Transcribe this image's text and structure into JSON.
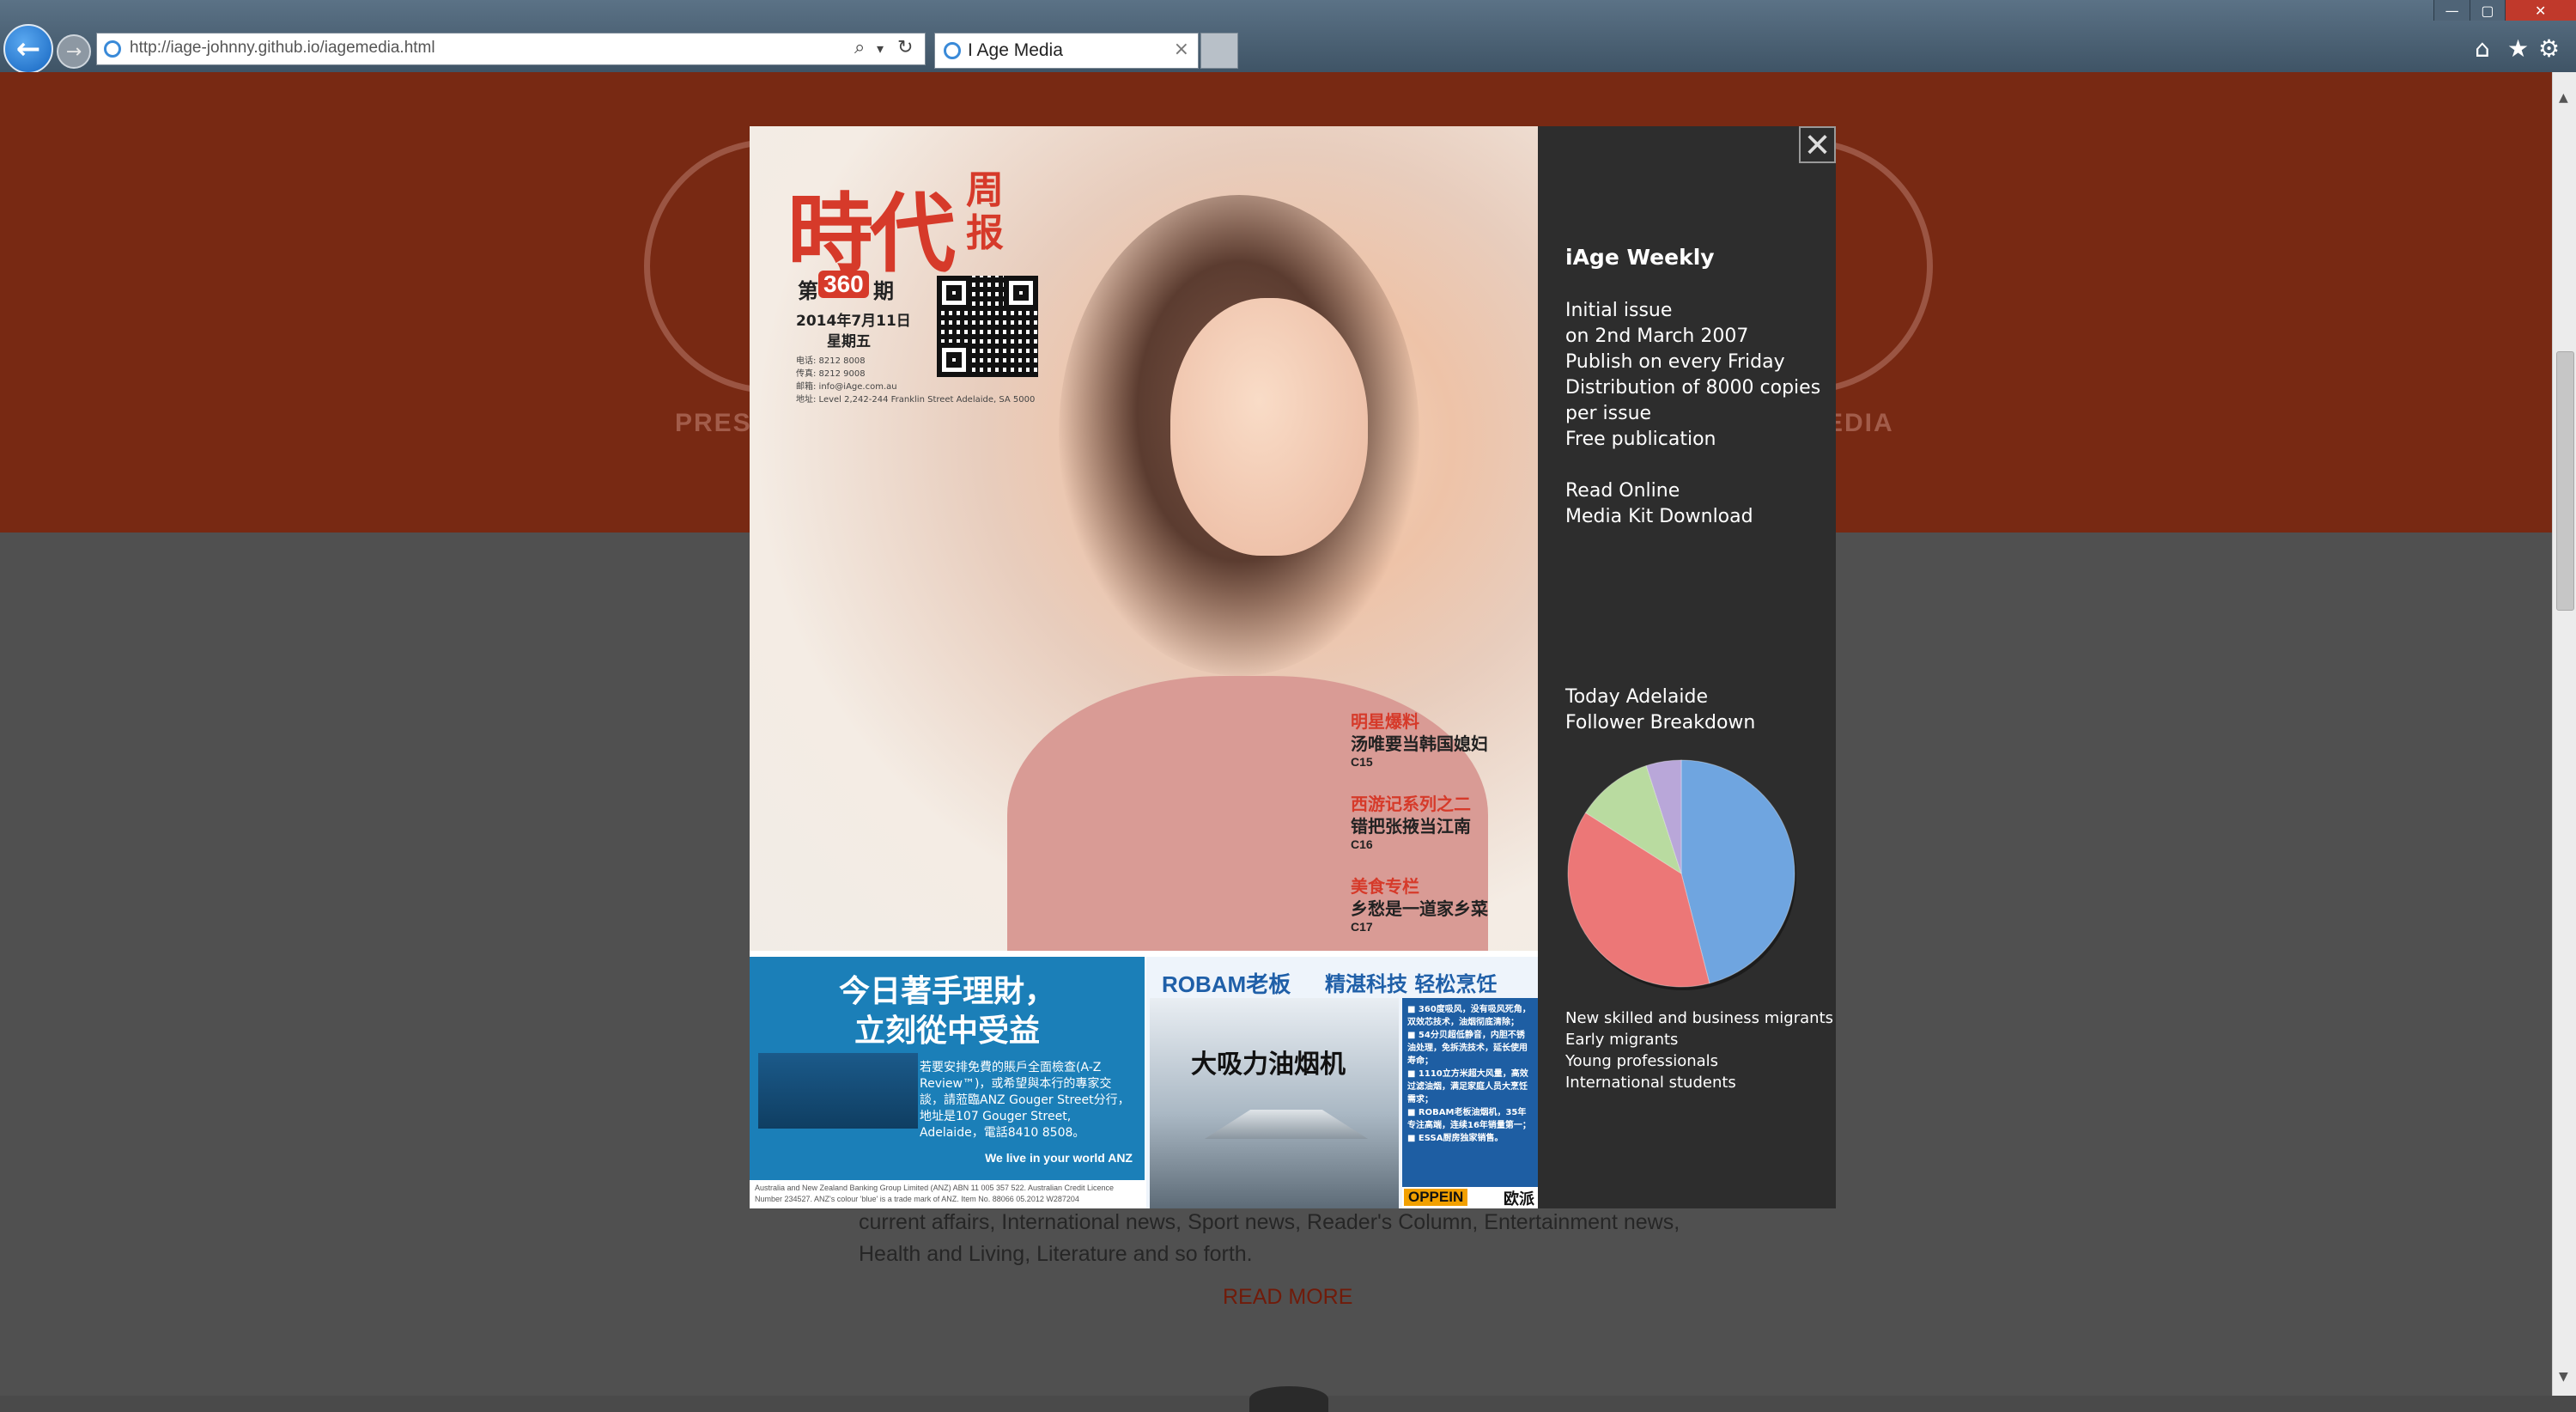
{
  "browser": {
    "url": "http://iage-johnny.github.io/iagemedia.html",
    "tab_title": "I Age Media",
    "back_glyph": "←",
    "forward_glyph": "→",
    "search_glyph": "⌕",
    "refresh_glyph": "↻",
    "dropdown_glyph": "▾",
    "tab_close_glyph": "×",
    "min_glyph": "—",
    "max_glyph": "▢",
    "close_glyph": "✕",
    "home_glyph": "⌂",
    "favorites_glyph": "★",
    "tools_glyph": "⚙",
    "icons": [
      "back-arrow-icon",
      "forward-arrow-icon",
      "search-icon",
      "refresh-icon",
      "home-icon",
      "star-icon",
      "gear-icon"
    ]
  },
  "page": {
    "header_left_label": "PRES",
    "header_right_label": "EDIA",
    "body_text": "current affairs, International news, Sport news, Reader's Column, Entertainment news, Health and Living, Literature and so forth.",
    "read_more": "READ MORE",
    "brand_color": "#782913"
  },
  "modal": {
    "close_glyph": "✕",
    "cover": {
      "logo": "時代",
      "logo_sub": "周报",
      "issue_prefix": "第",
      "issue_number": "360",
      "issue_suffix": "期",
      "date": "2014年7月11日",
      "weekday": "星期五",
      "contact": "电话: 8212 8008\n传真: 8212 9008\n邮箱: info@iAge.com.au\n地址: Level 2,242-244 Franklin Street Adelaide, SA 5000",
      "headlines": [
        {
          "category": "明星爆料",
          "title": "汤唯要当韩国媳妇",
          "page": "C15"
        },
        {
          "category": "西游记系列之二",
          "title": "错把张掖当江南",
          "page": "C16"
        },
        {
          "category": "美食专栏",
          "title": "乡愁是一道家乡菜",
          "page": "C17"
        }
      ],
      "ad_anz": {
        "headline": "今日著手理財，\n立刻從中受益",
        "body": "若要安排免費的賬戶全面檢查(A-Z Review™)，或希望與本行的專家交談，請蒞臨ANZ Gouger Street分行，地址是107 Gouger Street, Adelaide，電話8410 8508。",
        "slogan": "We live in your world ANZ",
        "footer": "Australia and New Zealand Banking Group Limited (ANZ) ABN 11 005 357 522. Australian Credit Licence Number 234527. ANZ's colour 'blue' is a trade mark of ANZ. Item No. 88066 05.2012 W287204"
      },
      "ad_robam": {
        "logo": "ROBAM老板",
        "slogan": "精湛科技 轻松烹饪",
        "title": "大吸力油烟机",
        "specs": "■ 360度吸风，没有吸风死角，双效芯技术，油烟彻底清除；\n■ 54分贝超低静音，内胆不锈油处理，免拆洗技术，延长使用寿命；\n■ 1110立方米超大风量，高效过滤油烟，满足家庭人员大烹饪需求；\n■ ROBAM老板油烟机，35年专注高端，连续16年销量第一；\n■ ESSA厨房独家销售。",
        "partner": "OPPEIN",
        "partner_cn": "欧派"
      }
    },
    "info": {
      "title": "iAge Weekly",
      "details": [
        "Initial issue",
        "on 2nd March 2007",
        "Publish on every Friday",
        "Distribution of 8000 copies",
        "per issue",
        "Free publication"
      ],
      "links": [
        "Read Online",
        "Media Kit Download"
      ],
      "pie_title": [
        "Today Adelaide",
        "Follower Breakdown"
      ]
    }
  },
  "chart_data": {
    "type": "pie",
    "categories": [
      "New skilled and business migrants",
      "Early migrants",
      "Young professionals",
      "International students"
    ],
    "values": [
      46,
      38,
      11,
      5
    ],
    "colors": [
      "#6fa5e0",
      "#ec7777",
      "#b9dba0",
      "#b9a7d9"
    ],
    "legend_position": "below"
  }
}
